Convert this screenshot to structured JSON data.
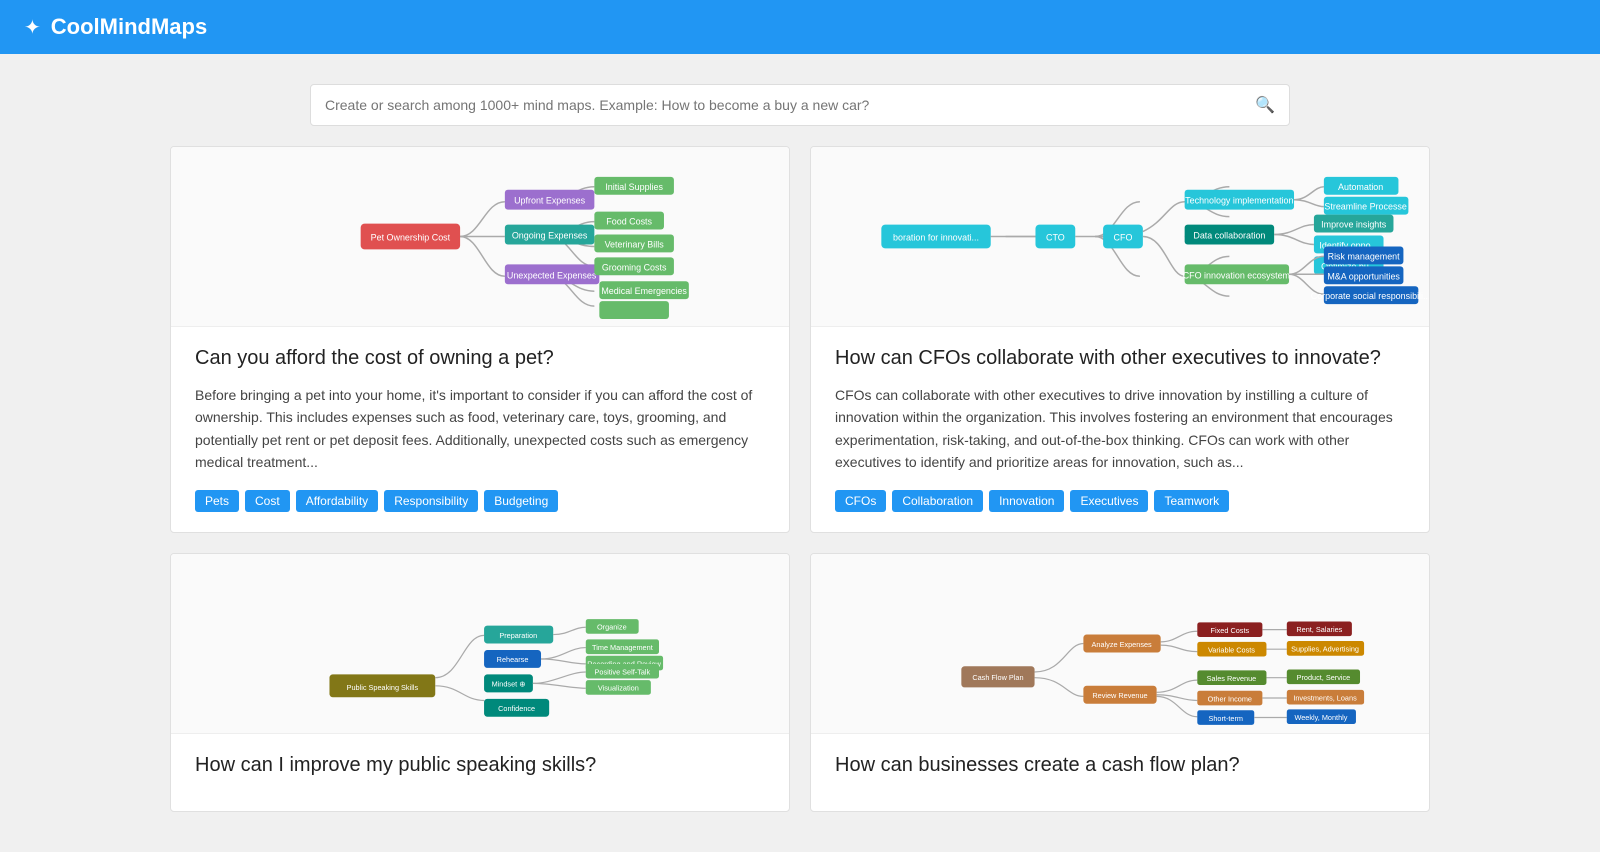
{
  "header": {
    "title": "CoolMindMaps",
    "logo_icon": "✦"
  },
  "search": {
    "placeholder": "Create or search among 1000+ mind maps. Example: How to become a buy a new car?"
  },
  "cards": [
    {
      "id": "pets",
      "title": "Can you afford the cost of owning a pet?",
      "description": "Before bringing a pet into your home, it's important to consider if you can afford the cost of ownership. This includes expenses such as food, veterinary care, toys, grooming, and potentially pet rent or pet deposit fees. Additionally, unexpected costs such as emergency medical treatment...",
      "tags": [
        "Pets",
        "Cost",
        "Affordability",
        "Responsibility",
        "Budgeting"
      ]
    },
    {
      "id": "cfo",
      "title": "How can CFOs collaborate with other executives to innovate?",
      "description": "CFOs can collaborate with other executives to drive innovation by instilling a culture of innovation within the organization. This involves fostering an environment that encourages experimentation, risk-taking, and out-of-the-box thinking. CFOs can work with other executives to identify and prioritize areas for innovation, such as...",
      "tags": [
        "CFOs",
        "Collaboration",
        "Innovation",
        "Executives",
        "Teamwork"
      ]
    },
    {
      "id": "speaking",
      "title": "How can I improve my public speaking skills?",
      "description": "",
      "tags": []
    },
    {
      "id": "cashflow",
      "title": "How can businesses create a cash flow plan?",
      "description": "",
      "tags": []
    }
  ]
}
